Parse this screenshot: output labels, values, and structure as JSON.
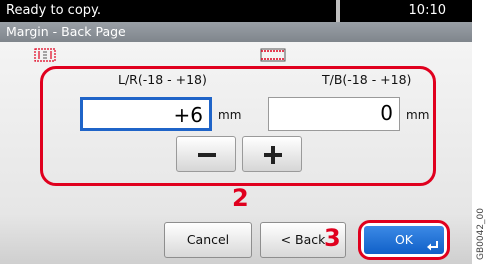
{
  "status": {
    "message": "Ready to copy.",
    "time": "10:10"
  },
  "title": "Margin - Back Page",
  "fields": {
    "lr": {
      "label": "L/R(-18 - +18)",
      "value": "+6",
      "unit": "mm",
      "icon": "left-right-margin-icon"
    },
    "tb": {
      "label": "T/B(-18 - +18)",
      "value": "0",
      "unit": "mm",
      "icon": "top-bottom-margin-icon"
    }
  },
  "steppers": {
    "minus_icon": "minus-icon",
    "plus_icon": "plus-icon"
  },
  "buttons": {
    "cancel": "Cancel",
    "back": "< Back",
    "ok": "OK"
  },
  "callouts": {
    "step2": "2",
    "step3": "3"
  },
  "side_code": "GB0042_00",
  "colors": {
    "highlight_red": "#e0001e",
    "ok_blue": "#1f6fd6",
    "field_focus": "#1f64c8"
  }
}
